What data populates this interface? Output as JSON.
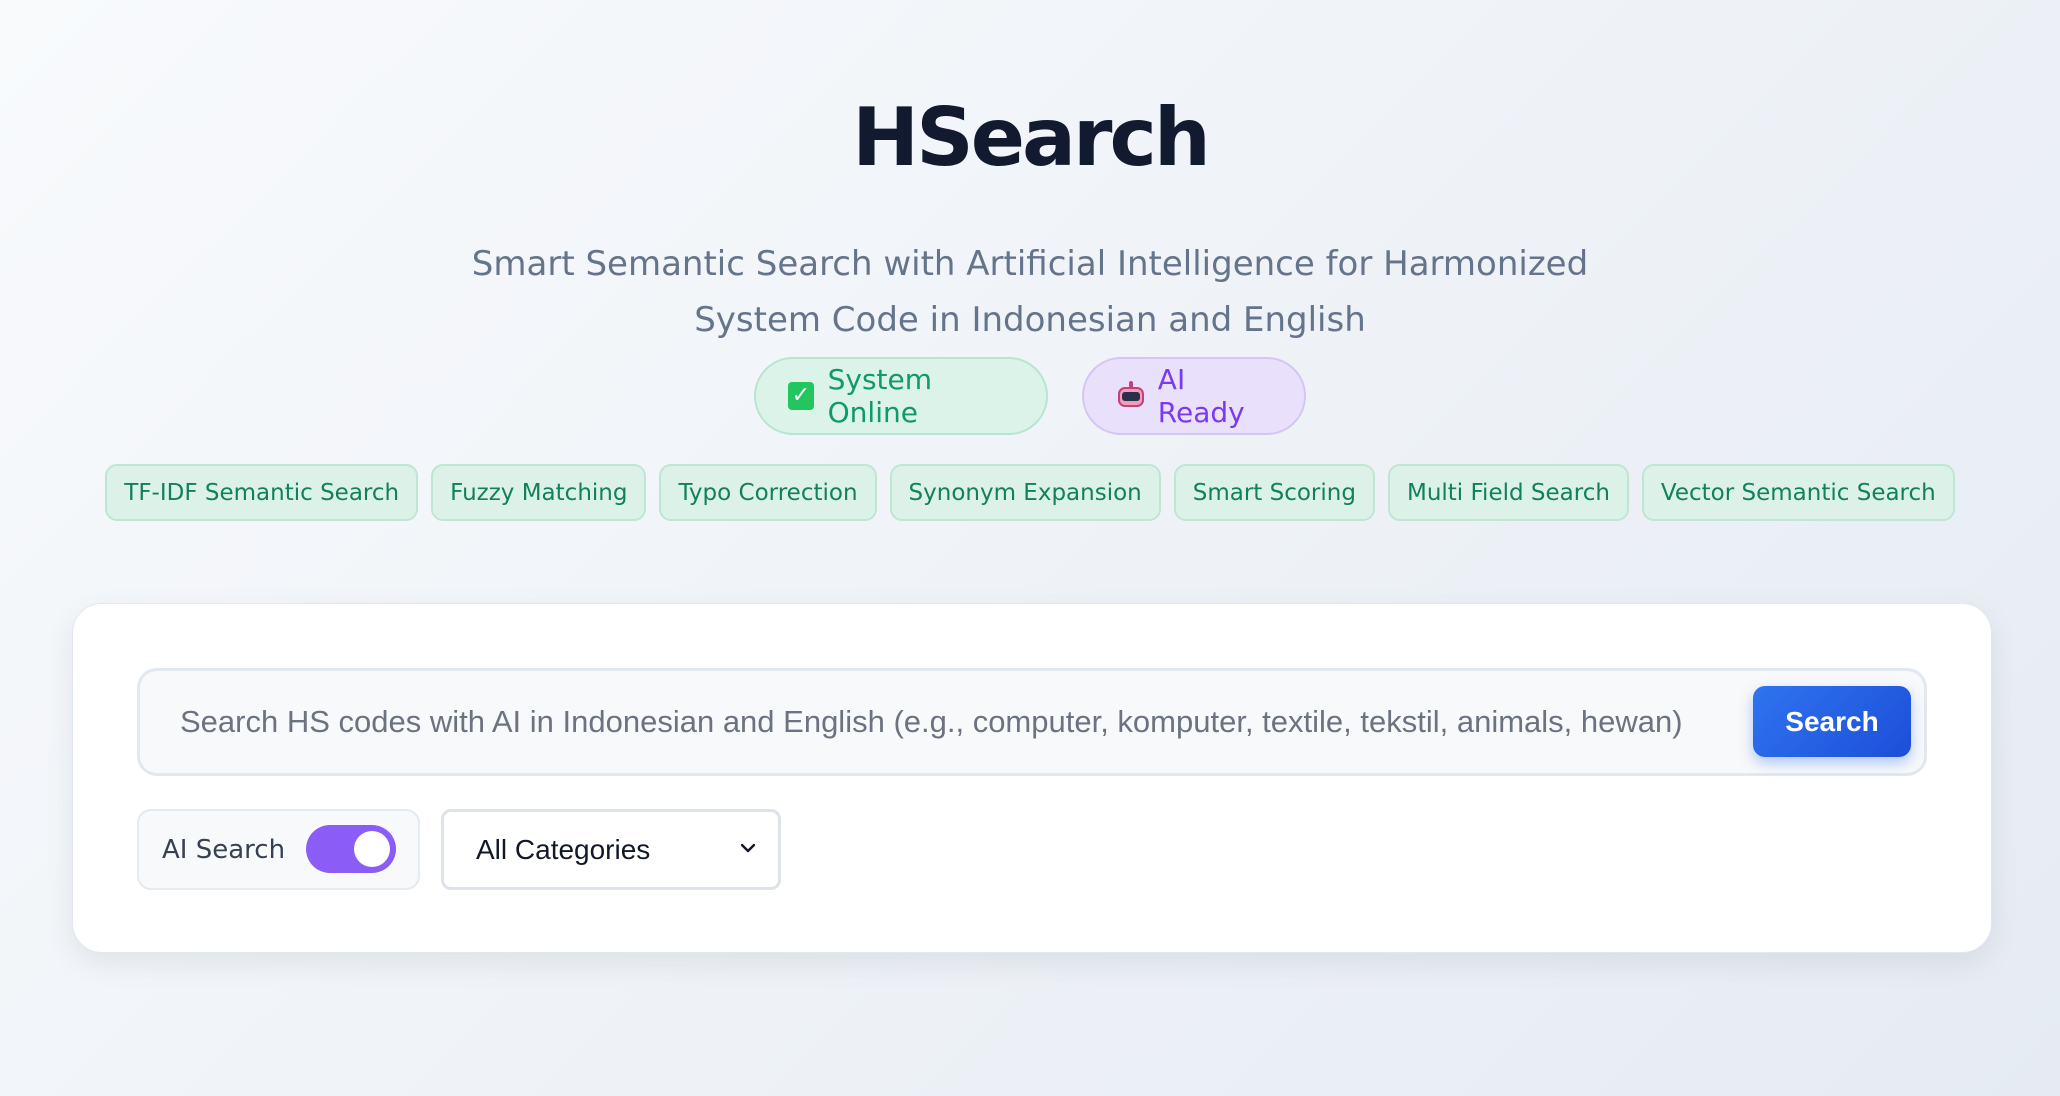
{
  "header": {
    "title": "HSearch",
    "subtitle": "Smart Semantic Search with Artificial Intelligence for Harmonized System Code in Indonesian and English"
  },
  "status": {
    "online": {
      "label": "System Online",
      "icon": "check-box-icon",
      "color": "#0f9a6a"
    },
    "ai": {
      "label": "AI Ready",
      "icon": "robot-icon",
      "color": "#7c3aed"
    }
  },
  "features": [
    "TF-IDF Semantic Search",
    "Fuzzy Matching",
    "Typo Correction",
    "Synonym Expansion",
    "Smart Scoring",
    "Multi Field Search",
    "Vector Semantic Search"
  ],
  "search": {
    "value": "",
    "placeholder": "Search HS codes with AI in Indonesian and English (e.g., computer, komputer, textile, tekstil, animals, hewan)",
    "button_label": "Search"
  },
  "controls": {
    "ai_search_label": "AI Search",
    "ai_search_enabled": true,
    "category_selected": "All Categories"
  },
  "colors": {
    "accent": "#2563eb",
    "toggle": "#8b5cf6",
    "feature_text": "#12805d"
  }
}
